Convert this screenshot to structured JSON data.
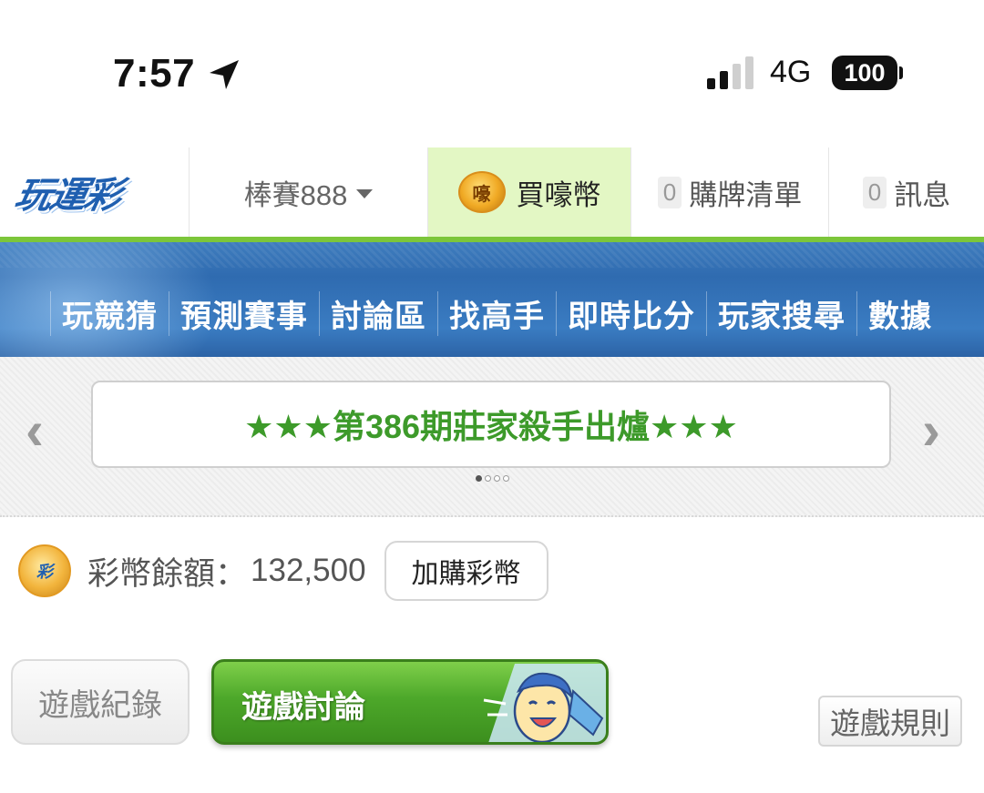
{
  "status_bar": {
    "time": "7:57",
    "network": "4G",
    "battery": "100"
  },
  "header": {
    "logo_text": "玩運彩",
    "username": "棒賽888",
    "buy_coin_label": "買嚎幣",
    "coin_icon_text": "嚎",
    "cart": {
      "count": "0",
      "label": "購牌清單"
    },
    "messages": {
      "count": "0",
      "label": "訊息"
    }
  },
  "nav": {
    "items": [
      "玩競猜",
      "預測賽事",
      "討論區",
      "找高手",
      "即時比分",
      "玩家搜尋",
      "數據"
    ]
  },
  "carousel": {
    "banner_text": "★★★第386期莊家殺手出爐★★★",
    "prev": "‹",
    "next": "›",
    "active_index": 0,
    "total": 4
  },
  "balance": {
    "coin_icon_text": "彩",
    "label": "彩幣餘額：",
    "value": "132,500",
    "topup_label": "加購彩幣"
  },
  "tabs": {
    "record_label": "遊戲紀錄",
    "discuss_label": "遊戲討論",
    "rules_label": "遊戲規則"
  },
  "colors": {
    "accent_green": "#3d9a2a",
    "nav_blue": "#2f6bb0",
    "buy_bg": "#e3f7c4"
  }
}
